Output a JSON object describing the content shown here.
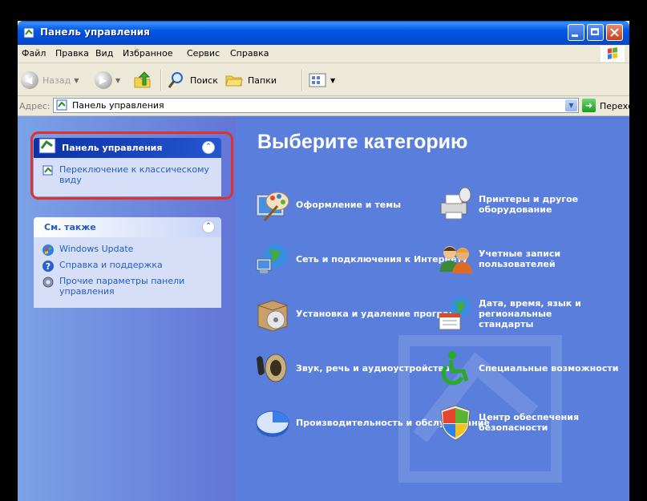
{
  "window": {
    "title": "Панель управления"
  },
  "menu": [
    "Файл",
    "Правка",
    "Вид",
    "Избранное",
    "Сервис",
    "Справка"
  ],
  "toolbar": {
    "back": "Назад",
    "search": "Поиск",
    "folders": "Папки"
  },
  "address": {
    "label": "Адрес:",
    "value": "Панель управления",
    "go": "Переход"
  },
  "leftpane": {
    "cp_panel": {
      "title": "Панель управления",
      "switch_link": "Переключение к классическому виду"
    },
    "see_also": {
      "title": "См. также",
      "links": [
        "Windows Update",
        "Справка и поддержка",
        "Прочие параметры панели управления"
      ]
    }
  },
  "main": {
    "heading": "Выберите категорию",
    "categories": [
      {
        "label": "Оформление и темы",
        "icon": "appearance-themes-icon"
      },
      {
        "label": "Принтеры и другое оборудование",
        "icon": "printer-hardware-icon"
      },
      {
        "label": "Сеть и подключения к Интернету",
        "icon": "network-globe-icon"
      },
      {
        "label": "Учетные записи пользователей",
        "icon": "user-accounts-icon"
      },
      {
        "label": "Установка и удаление программ",
        "icon": "install-programs-icon"
      },
      {
        "label": "Дата, время, язык и региональные стандарты",
        "icon": "date-time-globe-icon"
      },
      {
        "label": "Звук, речь и аудиоустройства",
        "icon": "speaker-icon"
      },
      {
        "label": "Специальные возможности",
        "icon": "accessibility-icon"
      },
      {
        "label": "Производительность и обслуживание",
        "icon": "performance-pie-icon"
      },
      {
        "label": "Центр обеспечения безопасности",
        "icon": "security-shield-icon"
      }
    ]
  },
  "colors": {
    "title_bar": "#0058e6",
    "left_pane": "#7ba2e7",
    "main_bg": "#5a7edc",
    "highlight": "#e0322a",
    "link": "#215dc6"
  }
}
